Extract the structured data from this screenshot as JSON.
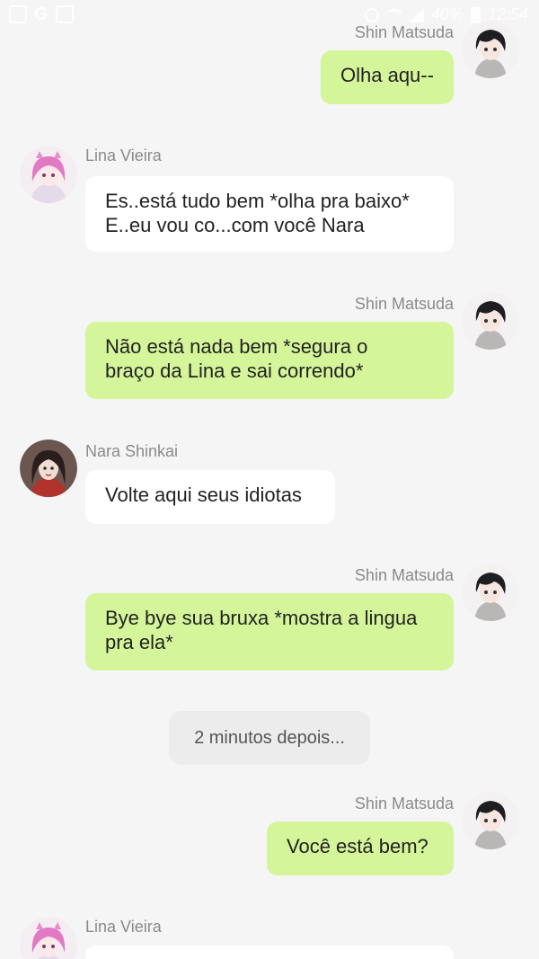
{
  "status_bar": {
    "left_icons": [
      "gallery-icon",
      "google-icon",
      "email-icon"
    ],
    "google_glyph": "G",
    "battery_text": "40%",
    "time": "12:54"
  },
  "messages": [
    {
      "sender": "Shin Matsuda",
      "direction": "outgoing",
      "lines": [
        "Olha aqu--"
      ]
    },
    {
      "sender": "Lina Vieira",
      "direction": "incoming",
      "lines": [
        "Es..está tudo bem *olha pra baixo*",
        "E..eu vou co...com você Nara"
      ]
    },
    {
      "sender": "Shin Matsuda",
      "direction": "outgoing",
      "lines": [
        "Não está nada bem *segura o",
        "braço da Lina e sai correndo*"
      ]
    },
    {
      "sender": "Nara Shinkai",
      "direction": "incoming",
      "lines": [
        "Volte aqui seus idiotas"
      ]
    },
    {
      "sender": "Shin Matsuda",
      "direction": "outgoing",
      "lines": [
        "Bye bye sua bruxa *mostra a lingua",
        "pra ela*"
      ]
    },
    {
      "sender": "Shin Matsuda",
      "direction": "outgoing",
      "lines": [
        "Você está bem?"
      ]
    },
    {
      "sender": "Lina Vieira",
      "direction": "incoming",
      "lines": [
        ""
      ]
    }
  ],
  "system_note": "2 minutos depois...",
  "colors": {
    "background": "#f5f5f5",
    "outgoing_bubble": "#d5f59a",
    "incoming_bubble": "#ffffff",
    "sender_name": "#8a8a8a",
    "system_note_bg": "#ececec"
  }
}
